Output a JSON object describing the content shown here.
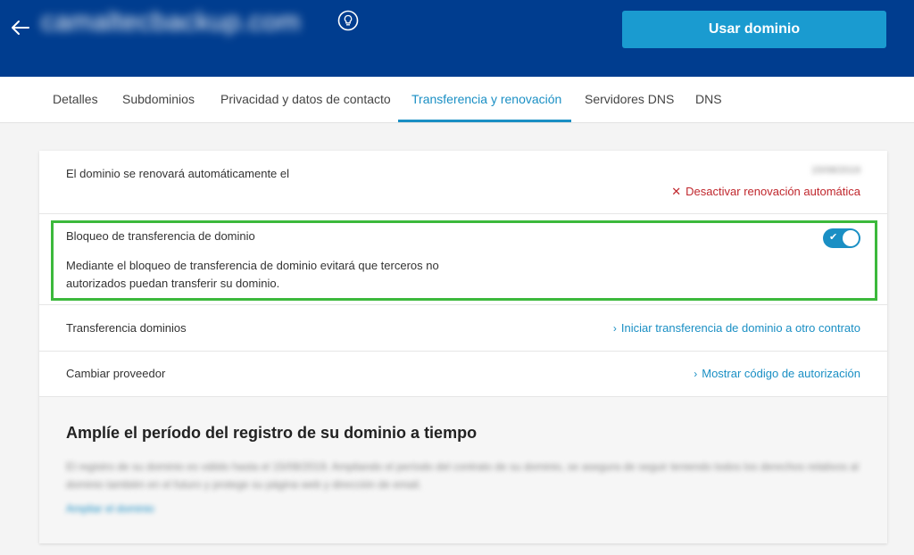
{
  "header": {
    "domain": "camaltecbackup.com",
    "primary_button": "Usar dominio",
    "colors": {
      "bar": "#003d8f",
      "button": "#1a9bd0"
    }
  },
  "tabs": [
    {
      "label": "Detalles"
    },
    {
      "label": "Subdominios"
    },
    {
      "label": "Privacidad y datos de contacto"
    },
    {
      "label": "Transferencia y renovación",
      "active": true
    },
    {
      "label": "Servidores DNS"
    },
    {
      "label": "DNS"
    }
  ],
  "renewal": {
    "label": "El dominio se renovará automáticamente el",
    "date": "15/08/2019",
    "deactivate_link": "Desactivar renovación automática"
  },
  "transfer_lock": {
    "label": "Bloqueo de transferencia de dominio",
    "description": "Mediante el bloqueo de transferencia de dominio evitará que terceros no autorizados puedan transferir su dominio.",
    "enabled": true
  },
  "transfer": {
    "label": "Transferencia dominios",
    "link": "Iniciar transferencia de dominio a otro contrato"
  },
  "provider": {
    "label": "Cambiar proveedor",
    "link": "Mostrar código de autorización"
  },
  "promo": {
    "title": "Amplíe el período del registro de su dominio a tiempo",
    "text": "El registro de su dominio es válido hasta el 15/08/2019. Ampliando el período del contrato de su dominio, se asegura de seguir teniendo todos los derechos relativos al dominio también en el futuro y protege su página web y dirección de email.",
    "link": "Ampliar el dominio"
  }
}
